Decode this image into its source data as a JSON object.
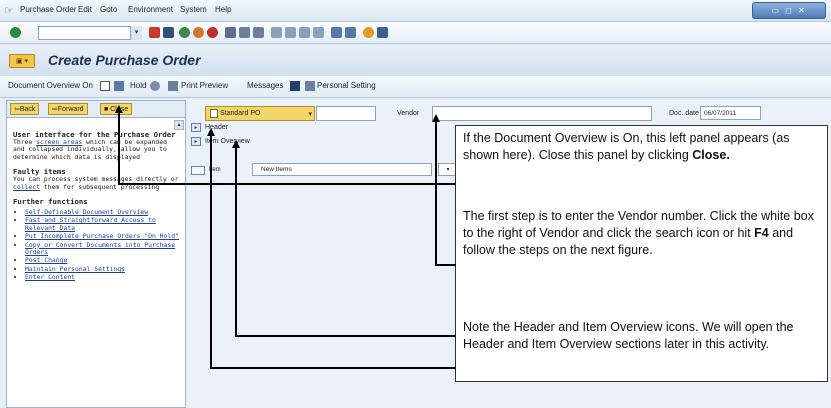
{
  "menu": {
    "items": [
      "Purchase Order",
      "Edit",
      "Goto",
      "Environment",
      "System",
      "Help"
    ]
  },
  "page_title": "Create Purchase Order",
  "app_toolbar": {
    "doc_overview": "Document Overview On",
    "hold": "Hold",
    "print_preview": "Print Preview",
    "messages": "Messages",
    "personal_setting": "Personal Setting"
  },
  "left_panel": {
    "back": "Back",
    "forward": "Forward",
    "close": "Close",
    "help_heading": "User interface for the Purchase Order",
    "help_text_1": "Three",
    "help_link_1": "screen areas",
    "help_text_2": "which can be expanded and collapsed individually, allow you to determine which data is displayed",
    "faulty_heading": "Faulty items",
    "faulty_text_1": "You can process system messages directly or",
    "faulty_link": "collect",
    "faulty_text_2": "them for subsequent processing",
    "further_heading": "Further functions",
    "further_links": [
      "Self-Definable Document Overview",
      "Fast and Straightforward Access to Relevant Data",
      "Put Incomplete Purchase Orders \"On Hold\"",
      "Copy or Convert Documents into Purchase Orders",
      "Post Change",
      "Maintain Personal Settings",
      "Enter Content"
    ]
  },
  "header_fields": {
    "po_type": "Standard PO",
    "vendor_label": "Vendor",
    "doc_date_label": "Doc. date",
    "doc_date_value": "06/07/2011"
  },
  "sections": {
    "header": "Header",
    "item_overview": "Item Overview",
    "item_row_label": "Item",
    "item_row_value": "New Items"
  },
  "callout": {
    "p1_text": "If the Document Overview is On, this left panel appears (as shown here). Close this panel by clicking ",
    "p1_bold": "Close.",
    "p2_text_a": "The first step is to enter the Vendor number. Click the white box to the right of  Vendor and click the search icon or hit ",
    "p2_bold": "F4",
    "p2_text_b": " and follow the steps on the next figure.",
    "p3_text": "Note the Header and Item Overview icons. We will open the Header and Item Overview sections later in this activity."
  },
  "colors": {
    "accent_yellow": "#f3d56a",
    "sap_blue": "#1b2f52",
    "background": "#e6eef6"
  }
}
